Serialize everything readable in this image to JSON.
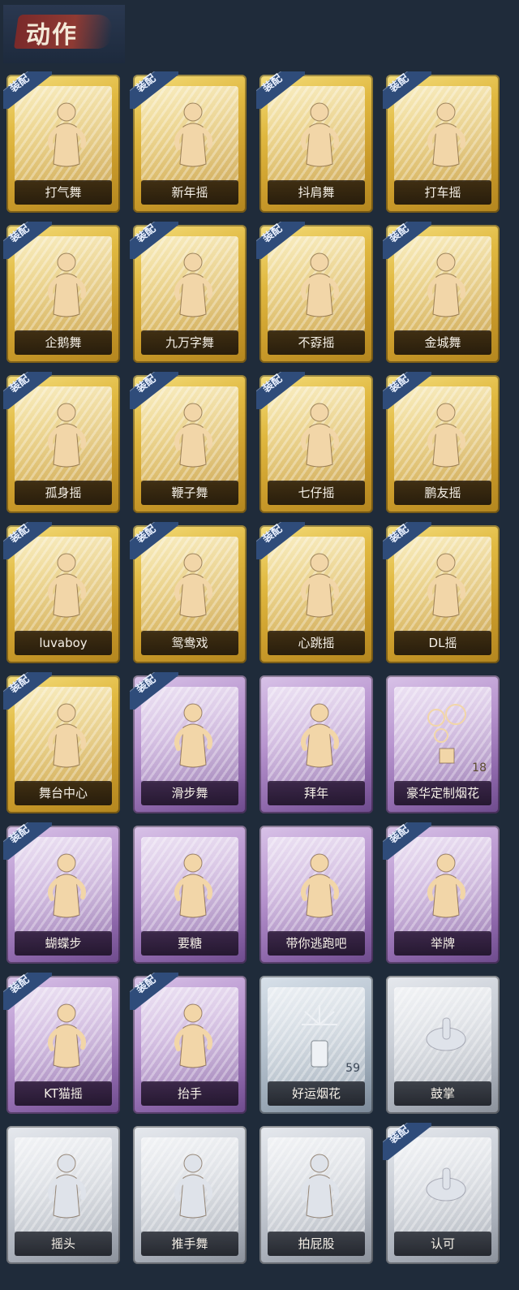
{
  "header": {
    "title": "动作"
  },
  "equip_label": "装配",
  "cards": [
    {
      "label": "打气舞",
      "tier": "gold",
      "equipped": true,
      "icon": "dance-figure-icon"
    },
    {
      "label": "新年摇",
      "tier": "gold",
      "equipped": true,
      "icon": "dance-figure-icon"
    },
    {
      "label": "抖肩舞",
      "tier": "gold",
      "equipped": true,
      "icon": "dance-figure-icon"
    },
    {
      "label": "打车摇",
      "tier": "gold",
      "equipped": true,
      "icon": "dance-figure-icon"
    },
    {
      "label": "企鹅舞",
      "tier": "gold",
      "equipped": true,
      "icon": "dance-figure-icon"
    },
    {
      "label": "九万字舞",
      "tier": "gold",
      "equipped": true,
      "icon": "dance-figure-icon"
    },
    {
      "label": "不孬摇",
      "tier": "gold",
      "equipped": true,
      "icon": "dance-figure-icon"
    },
    {
      "label": "金城舞",
      "tier": "gold",
      "equipped": true,
      "icon": "dance-figure-icon"
    },
    {
      "label": "孤身摇",
      "tier": "gold",
      "equipped": true,
      "icon": "dance-figure-icon"
    },
    {
      "label": "鞭子舞",
      "tier": "gold",
      "equipped": true,
      "icon": "dance-figure-icon"
    },
    {
      "label": "七仔摇",
      "tier": "gold",
      "equipped": true,
      "icon": "dance-figure-icon"
    },
    {
      "label": "鹏友摇",
      "tier": "gold",
      "equipped": true,
      "icon": "dance-figure-icon"
    },
    {
      "label": "luvaboy",
      "tier": "gold",
      "equipped": true,
      "icon": "dance-figure-icon"
    },
    {
      "label": "鸳鸯戏",
      "tier": "gold",
      "equipped": true,
      "icon": "dance-figure-icon"
    },
    {
      "label": "心跳摇",
      "tier": "gold",
      "equipped": true,
      "icon": "dance-figure-icon"
    },
    {
      "label": "DL摇",
      "tier": "gold",
      "equipped": true,
      "icon": "dance-figure-icon"
    },
    {
      "label": "舞台中心",
      "tier": "gold",
      "equipped": true,
      "icon": "dance-figure-icon"
    },
    {
      "label": "滑步舞",
      "tier": "purple",
      "equipped": true,
      "icon": "dance-figure-icon"
    },
    {
      "label": "拜年",
      "tier": "purple",
      "equipped": false,
      "icon": "bow-figure-icon"
    },
    {
      "label": "豪华定制烟花",
      "tier": "purple",
      "equipped": false,
      "icon": "fireworks-icon",
      "count": "18"
    },
    {
      "label": "蝴蝶步",
      "tier": "purple",
      "equipped": true,
      "icon": "dance-figure-icon"
    },
    {
      "label": "要糖",
      "tier": "purple",
      "equipped": false,
      "icon": "reach-figure-icon"
    },
    {
      "label": "带你逃跑吧",
      "tier": "purple",
      "equipped": false,
      "icon": "dance-figure-icon"
    },
    {
      "label": "举牌",
      "tier": "purple",
      "equipped": true,
      "icon": "sign-figure-icon"
    },
    {
      "label": "KT猫摇",
      "tier": "purple",
      "equipped": true,
      "icon": "dance-figure-icon"
    },
    {
      "label": "抬手",
      "tier": "purple",
      "equipped": true,
      "icon": "reach-figure-icon"
    },
    {
      "label": "好运烟花",
      "tier": "blue",
      "equipped": false,
      "icon": "firework-tube-icon",
      "count": "59"
    },
    {
      "label": "鼓掌",
      "tier": "silver",
      "equipped": false,
      "icon": "clap-hands-icon"
    },
    {
      "label": "摇头",
      "tier": "silver",
      "equipped": false,
      "icon": "shake-head-figure-icon"
    },
    {
      "label": "推手舞",
      "tier": "silver",
      "equipped": false,
      "icon": "push-figure-icon"
    },
    {
      "label": "拍屁股",
      "tier": "silver",
      "equipped": false,
      "icon": "bend-figure-icon"
    },
    {
      "label": "认可",
      "tier": "silver",
      "equipped": true,
      "icon": "thumbs-up-icon"
    }
  ],
  "colors": {
    "background": "#1f2b3a",
    "gold": "#e0b840",
    "purple": "#b895cf",
    "silver": "#c9ced6",
    "blue": "#b8c4d0",
    "equip_ribbon": "#2f4c7a",
    "header_brush": "#8f3a33"
  }
}
